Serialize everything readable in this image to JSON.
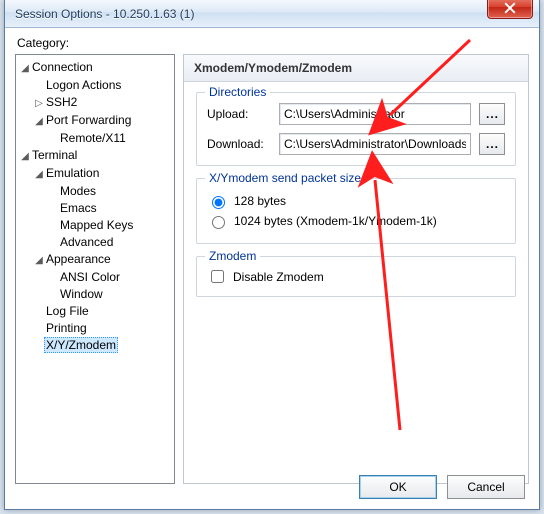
{
  "window": {
    "title": "Session Options - 10.250.1.63 (1)"
  },
  "category_label": "Category:",
  "tree": {
    "connection": "Connection",
    "logon_actions": "Logon Actions",
    "ssh2": "SSH2",
    "port_forwarding": "Port Forwarding",
    "remote_x11": "Remote/X11",
    "terminal": "Terminal",
    "emulation": "Emulation",
    "modes": "Modes",
    "emacs": "Emacs",
    "mapped_keys": "Mapped Keys",
    "advanced": "Advanced",
    "appearance": "Appearance",
    "ansi_color": "ANSI Color",
    "window": "Window",
    "log_file": "Log File",
    "printing": "Printing",
    "xyzmodem": "X/Y/Zmodem"
  },
  "panel": {
    "header": "Xmodem/Ymodem/Zmodem",
    "directories": {
      "legend": "Directories",
      "upload_label": "Upload:",
      "upload_value": "C:\\Users\\Administrator",
      "download_label": "Download:",
      "download_value": "C:\\Users\\Administrator\\Downloads",
      "browse": "..."
    },
    "packet": {
      "legend": "X/Ymodem send packet size",
      "opt128": "128 bytes",
      "opt1024": "1024 bytes  (Xmodem-1k/Ymodem-1k)"
    },
    "zmodem": {
      "legend": "Zmodem",
      "disable": "Disable Zmodem"
    }
  },
  "buttons": {
    "ok": "OK",
    "cancel": "Cancel"
  }
}
